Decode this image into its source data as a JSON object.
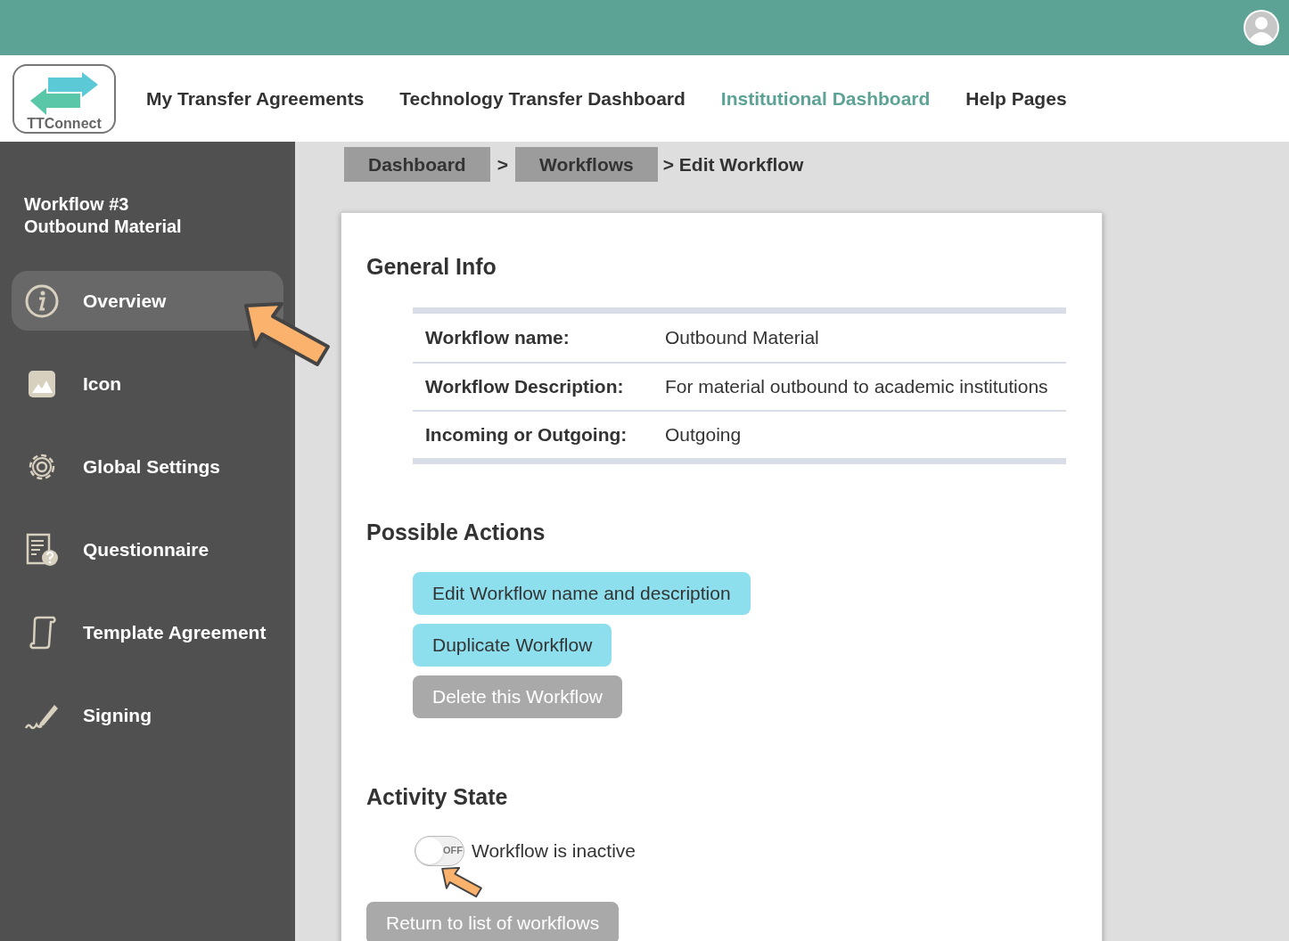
{
  "logo": {
    "text": "TTConnect"
  },
  "nav": [
    {
      "label": "My Transfer Agreements",
      "selected": false
    },
    {
      "label": "Technology Transfer Dashboard",
      "selected": false
    },
    {
      "label": "Institutional Dashboard",
      "selected": true
    },
    {
      "label": "Help Pages",
      "selected": false
    }
  ],
  "sidebar": {
    "title": "Workflow #3",
    "subtitle": "Outbound Material",
    "items": [
      {
        "label": "Overview",
        "selected": true
      },
      {
        "label": "Icon",
        "selected": false
      },
      {
        "label": "Global Settings",
        "selected": false
      },
      {
        "label": "Questionnaire",
        "selected": false
      },
      {
        "label": "Template Agreement",
        "selected": false
      },
      {
        "label": "Signing",
        "selected": false
      }
    ]
  },
  "breadcrumb": [
    {
      "kind": "link",
      "label": "Dashboard"
    },
    {
      "kind": "separator",
      "label": ">"
    },
    {
      "kind": "link",
      "label": "Workflows"
    },
    {
      "kind": "current",
      "label": "> Edit Workflow"
    }
  ],
  "general_info": {
    "title": "General Info",
    "rows": [
      {
        "label": "Workflow name:",
        "value": "Outbound Material"
      },
      {
        "label": "Workflow Description:",
        "value": "For material outbound to academic institutions"
      },
      {
        "label": "Incoming or Outgoing:",
        "value": "Outgoing"
      }
    ]
  },
  "possible_actions": {
    "title": "Possible Actions",
    "buttons": [
      {
        "kind": "primary",
        "label": "Edit Workflow name and description"
      },
      {
        "kind": "primary",
        "label": "Duplicate Workflow"
      },
      {
        "kind": "disabled",
        "label": "Delete this Workflow"
      }
    ]
  },
  "activity_state": {
    "title": "Activity State",
    "toggle": {
      "on": false,
      "off_label": "OFF",
      "label": "Workflow is inactive"
    }
  },
  "return_button": {
    "label": "Return to list of workflows"
  }
}
